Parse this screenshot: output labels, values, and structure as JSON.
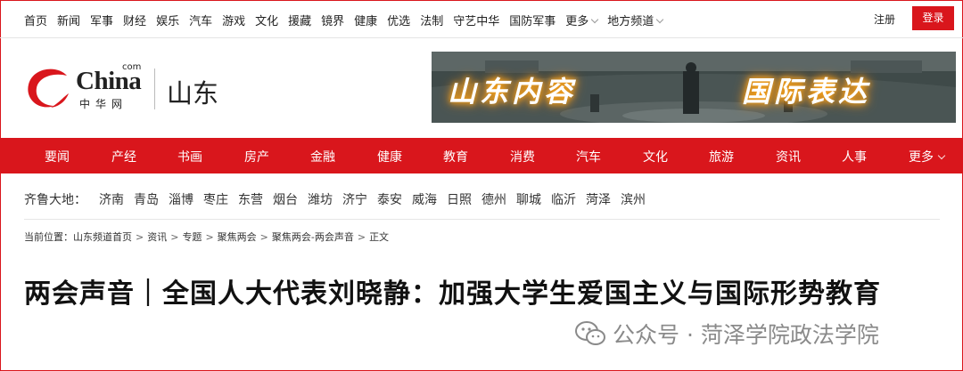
{
  "top_nav": {
    "items": [
      "首页",
      "新闻",
      "军事",
      "财经",
      "娱乐",
      "汽车",
      "游戏",
      "文化",
      "援藏",
      "镜界",
      "健康",
      "优选",
      "法制",
      "守艺中华",
      "国防军事"
    ],
    "more_label": "更多",
    "regional_label": "地方频道",
    "register_label": "注册",
    "login_label": "登录"
  },
  "logo": {
    "brand": "China",
    "com": "com",
    "cn_name": "中华网",
    "region": "山东",
    "brand_color": "#d9161c"
  },
  "banner": {
    "text_left": "山东内容",
    "text_right": "国际表达"
  },
  "main_nav": {
    "items": [
      "要闻",
      "产经",
      "书画",
      "房产",
      "金融",
      "健康",
      "教育",
      "消费",
      "汽车",
      "文化",
      "旅游",
      "资讯",
      "人事"
    ],
    "more_label": "更多",
    "background": "#d9161c"
  },
  "cities": {
    "label": "齐鲁大地：",
    "items": [
      "济南",
      "青岛",
      "淄博",
      "枣庄",
      "东营",
      "烟台",
      "潍坊",
      "济宁",
      "泰安",
      "威海",
      "日照",
      "德州",
      "聊城",
      "临沂",
      "菏泽",
      "滨州"
    ]
  },
  "breadcrumb": {
    "prefix": "当前位置：",
    "items": [
      "山东频道首页",
      "资讯",
      "专题",
      "聚焦两会",
      "聚焦两会-两会声音",
      "正文"
    ]
  },
  "article": {
    "title": "两会声音｜全国人大代表刘晓静：加强大学生爱国主义与国际形势教育"
  },
  "watermark": {
    "text": "公众号 · 菏泽学院政法学院",
    "icon": "wechat-icon"
  }
}
